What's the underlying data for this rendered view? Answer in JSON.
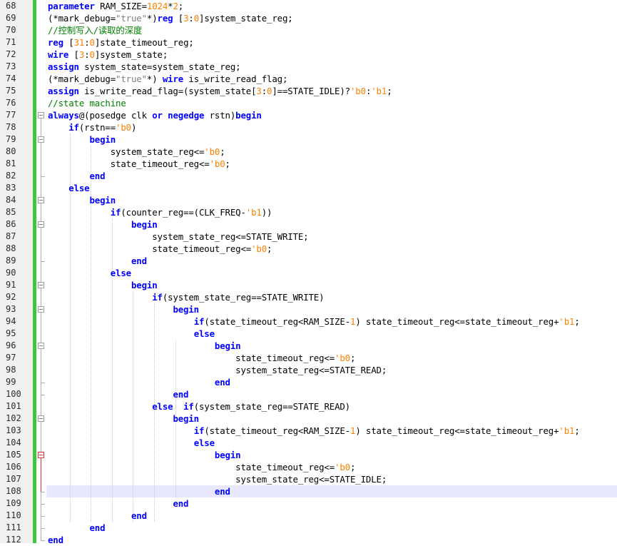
{
  "editor": {
    "colors": {
      "keyword": "#0000ff",
      "number": "#ff8000",
      "string": "#808080",
      "comment": "#008000",
      "change_bar": "#3cc83c",
      "current_line": "#e8e8ff"
    },
    "current_line": 108,
    "lines": [
      {
        "n": "68",
        "tokens": [
          {
            "t": "kw",
            "v": "parameter"
          },
          {
            "t": "p",
            "v": " RAM_SIZE="
          },
          {
            "t": "num",
            "v": "1024"
          },
          {
            "t": "p",
            "v": "*"
          },
          {
            "t": "num",
            "v": "2"
          },
          {
            "t": "p",
            "v": ";"
          }
        ]
      },
      {
        "n": "69",
        "tokens": [
          {
            "t": "p",
            "v": "(*mark_debug="
          },
          {
            "t": "str",
            "v": "\"true\""
          },
          {
            "t": "p",
            "v": "*)"
          },
          {
            "t": "kw",
            "v": "reg"
          },
          {
            "t": "p",
            "v": " ["
          },
          {
            "t": "num",
            "v": "3"
          },
          {
            "t": "p",
            "v": ":"
          },
          {
            "t": "num",
            "v": "0"
          },
          {
            "t": "p",
            "v": "]system_state_reg;"
          }
        ]
      },
      {
        "n": "70",
        "tokens": [
          {
            "t": "cmt",
            "v": "//控制写入/读取的深度"
          }
        ]
      },
      {
        "n": "71",
        "tokens": [
          {
            "t": "kw",
            "v": "reg"
          },
          {
            "t": "p",
            "v": " ["
          },
          {
            "t": "num",
            "v": "31"
          },
          {
            "t": "p",
            "v": ":"
          },
          {
            "t": "num",
            "v": "0"
          },
          {
            "t": "p",
            "v": "]state_timeout_reg;"
          }
        ]
      },
      {
        "n": "72",
        "tokens": [
          {
            "t": "kw",
            "v": "wire"
          },
          {
            "t": "p",
            "v": " ["
          },
          {
            "t": "num",
            "v": "3"
          },
          {
            "t": "p",
            "v": ":"
          },
          {
            "t": "num",
            "v": "0"
          },
          {
            "t": "p",
            "v": "]system_state;"
          }
        ]
      },
      {
        "n": "73",
        "tokens": [
          {
            "t": "kw",
            "v": "assign"
          },
          {
            "t": "p",
            "v": " system_state=system_state_reg;"
          }
        ]
      },
      {
        "n": "74",
        "tokens": [
          {
            "t": "p",
            "v": "(*mark_debug="
          },
          {
            "t": "str",
            "v": "\"true\""
          },
          {
            "t": "p",
            "v": "*) "
          },
          {
            "t": "kw",
            "v": "wire"
          },
          {
            "t": "p",
            "v": " is_write_read_flag;"
          }
        ]
      },
      {
        "n": "75",
        "tokens": [
          {
            "t": "kw",
            "v": "assign"
          },
          {
            "t": "p",
            "v": " is_write_read_flag=(system_state["
          },
          {
            "t": "num",
            "v": "3"
          },
          {
            "t": "p",
            "v": ":"
          },
          {
            "t": "num",
            "v": "0"
          },
          {
            "t": "p",
            "v": "]==STATE_IDLE)?"
          },
          {
            "t": "num",
            "v": "'b0"
          },
          {
            "t": "p",
            "v": ":"
          },
          {
            "t": "num",
            "v": "'b1"
          },
          {
            "t": "p",
            "v": ";"
          }
        ]
      },
      {
        "n": "76",
        "tokens": [
          {
            "t": "cmt",
            "v": "//state machine"
          }
        ]
      },
      {
        "n": "77",
        "tokens": [
          {
            "t": "kw",
            "v": "always"
          },
          {
            "t": "p",
            "v": "@(posedge clk "
          },
          {
            "t": "kw",
            "v": "or"
          },
          {
            "t": "p",
            "v": " "
          },
          {
            "t": "kw",
            "v": "negedge"
          },
          {
            "t": "p",
            "v": " rstn)"
          },
          {
            "t": "kw",
            "v": "begin"
          }
        ]
      },
      {
        "n": "78",
        "tokens": [
          {
            "t": "p",
            "v": "    "
          },
          {
            "t": "kw",
            "v": "if"
          },
          {
            "t": "p",
            "v": "(rstn=="
          },
          {
            "t": "num",
            "v": "'b0"
          },
          {
            "t": "p",
            "v": ")"
          }
        ]
      },
      {
        "n": "79",
        "tokens": [
          {
            "t": "p",
            "v": "        "
          },
          {
            "t": "kw",
            "v": "begin"
          }
        ]
      },
      {
        "n": "80",
        "tokens": [
          {
            "t": "p",
            "v": "            system_state_reg<="
          },
          {
            "t": "num",
            "v": "'b0"
          },
          {
            "t": "p",
            "v": ";"
          }
        ]
      },
      {
        "n": "81",
        "tokens": [
          {
            "t": "p",
            "v": "            state_timeout_reg<="
          },
          {
            "t": "num",
            "v": "'b0"
          },
          {
            "t": "p",
            "v": ";"
          }
        ]
      },
      {
        "n": "82",
        "tokens": [
          {
            "t": "p",
            "v": "        "
          },
          {
            "t": "kw",
            "v": "end"
          }
        ]
      },
      {
        "n": "83",
        "tokens": [
          {
            "t": "p",
            "v": "    "
          },
          {
            "t": "kw",
            "v": "else"
          }
        ]
      },
      {
        "n": "84",
        "tokens": [
          {
            "t": "p",
            "v": "        "
          },
          {
            "t": "kw",
            "v": "begin"
          }
        ]
      },
      {
        "n": "85",
        "tokens": [
          {
            "t": "p",
            "v": "            "
          },
          {
            "t": "kw",
            "v": "if"
          },
          {
            "t": "p",
            "v": "(counter_reg==(CLK_FREQ-"
          },
          {
            "t": "num",
            "v": "'b1"
          },
          {
            "t": "p",
            "v": "))"
          }
        ]
      },
      {
        "n": "86",
        "tokens": [
          {
            "t": "p",
            "v": "                "
          },
          {
            "t": "kw",
            "v": "begin"
          }
        ]
      },
      {
        "n": "87",
        "tokens": [
          {
            "t": "p",
            "v": "                    system_state_reg<=STATE_WRITE;"
          }
        ]
      },
      {
        "n": "88",
        "tokens": [
          {
            "t": "p",
            "v": "                    state_timeout_reg<="
          },
          {
            "t": "num",
            "v": "'b0"
          },
          {
            "t": "p",
            "v": ";"
          }
        ]
      },
      {
        "n": "89",
        "tokens": [
          {
            "t": "p",
            "v": "                "
          },
          {
            "t": "kw",
            "v": "end"
          }
        ]
      },
      {
        "n": "90",
        "tokens": [
          {
            "t": "p",
            "v": "            "
          },
          {
            "t": "kw",
            "v": "else"
          }
        ]
      },
      {
        "n": "91",
        "tokens": [
          {
            "t": "p",
            "v": "                "
          },
          {
            "t": "kw",
            "v": "begin"
          }
        ]
      },
      {
        "n": "92",
        "tokens": [
          {
            "t": "p",
            "v": "                    "
          },
          {
            "t": "kw",
            "v": "if"
          },
          {
            "t": "p",
            "v": "(system_state_reg==STATE_WRITE)"
          }
        ]
      },
      {
        "n": "93",
        "tokens": [
          {
            "t": "p",
            "v": "                        "
          },
          {
            "t": "kw",
            "v": "begin"
          }
        ]
      },
      {
        "n": "94",
        "tokens": [
          {
            "t": "p",
            "v": "                            "
          },
          {
            "t": "kw",
            "v": "if"
          },
          {
            "t": "p",
            "v": "(state_timeout_reg<RAM_SIZE-"
          },
          {
            "t": "num",
            "v": "1"
          },
          {
            "t": "p",
            "v": ") state_timeout_reg<=state_timeout_reg+"
          },
          {
            "t": "num",
            "v": "'b1"
          },
          {
            "t": "p",
            "v": ";"
          }
        ]
      },
      {
        "n": "95",
        "tokens": [
          {
            "t": "p",
            "v": "                            "
          },
          {
            "t": "kw",
            "v": "else"
          }
        ]
      },
      {
        "n": "96",
        "tokens": [
          {
            "t": "p",
            "v": "                                "
          },
          {
            "t": "kw",
            "v": "begin"
          }
        ]
      },
      {
        "n": "97",
        "tokens": [
          {
            "t": "p",
            "v": "                                    state_timeout_reg<="
          },
          {
            "t": "num",
            "v": "'b0"
          },
          {
            "t": "p",
            "v": ";"
          }
        ]
      },
      {
        "n": "98",
        "tokens": [
          {
            "t": "p",
            "v": "                                    system_state_reg<=STATE_READ;"
          }
        ]
      },
      {
        "n": "99",
        "tokens": [
          {
            "t": "p",
            "v": "                                "
          },
          {
            "t": "kw",
            "v": "end"
          }
        ]
      },
      {
        "n": "100",
        "tokens": [
          {
            "t": "p",
            "v": "                        "
          },
          {
            "t": "kw",
            "v": "end"
          }
        ]
      },
      {
        "n": "101",
        "tokens": [
          {
            "t": "p",
            "v": "                    "
          },
          {
            "t": "kw",
            "v": "else"
          },
          {
            "t": "p",
            "v": "  "
          },
          {
            "t": "kw",
            "v": "if"
          },
          {
            "t": "p",
            "v": "(system_state_reg==STATE_READ)"
          }
        ]
      },
      {
        "n": "102",
        "tokens": [
          {
            "t": "p",
            "v": "                        "
          },
          {
            "t": "kw",
            "v": "begin"
          }
        ]
      },
      {
        "n": "103",
        "tokens": [
          {
            "t": "p",
            "v": "                            "
          },
          {
            "t": "kw",
            "v": "if"
          },
          {
            "t": "p",
            "v": "(state_timeout_reg<RAM_SIZE-"
          },
          {
            "t": "num",
            "v": "1"
          },
          {
            "t": "p",
            "v": ") state_timeout_reg<=state_timeout_reg+"
          },
          {
            "t": "num",
            "v": "'b1"
          },
          {
            "t": "p",
            "v": ";"
          }
        ]
      },
      {
        "n": "104",
        "tokens": [
          {
            "t": "p",
            "v": "                            "
          },
          {
            "t": "kw",
            "v": "else"
          }
        ]
      },
      {
        "n": "105",
        "tokens": [
          {
            "t": "p",
            "v": "                                "
          },
          {
            "t": "kw",
            "v": "begin"
          }
        ]
      },
      {
        "n": "106",
        "tokens": [
          {
            "t": "p",
            "v": "                                    state_timeout_reg<="
          },
          {
            "t": "num",
            "v": "'b0"
          },
          {
            "t": "p",
            "v": ";"
          }
        ]
      },
      {
        "n": "107",
        "tokens": [
          {
            "t": "p",
            "v": "                                    system_state_reg<=STATE_IDLE;"
          }
        ]
      },
      {
        "n": "108",
        "tokens": [
          {
            "t": "p",
            "v": "                                "
          },
          {
            "t": "kw",
            "v": "end"
          }
        ]
      },
      {
        "n": "109",
        "tokens": [
          {
            "t": "p",
            "v": "                        "
          },
          {
            "t": "kw",
            "v": "end"
          }
        ]
      },
      {
        "n": "110",
        "tokens": [
          {
            "t": "p",
            "v": "                "
          },
          {
            "t": "kw",
            "v": "end"
          }
        ]
      },
      {
        "n": "111",
        "tokens": [
          {
            "t": "p",
            "v": "        "
          },
          {
            "t": "kw",
            "v": "end"
          }
        ]
      },
      {
        "n": "112",
        "tokens": [
          {
            "t": "kw",
            "v": "end"
          }
        ]
      }
    ]
  }
}
